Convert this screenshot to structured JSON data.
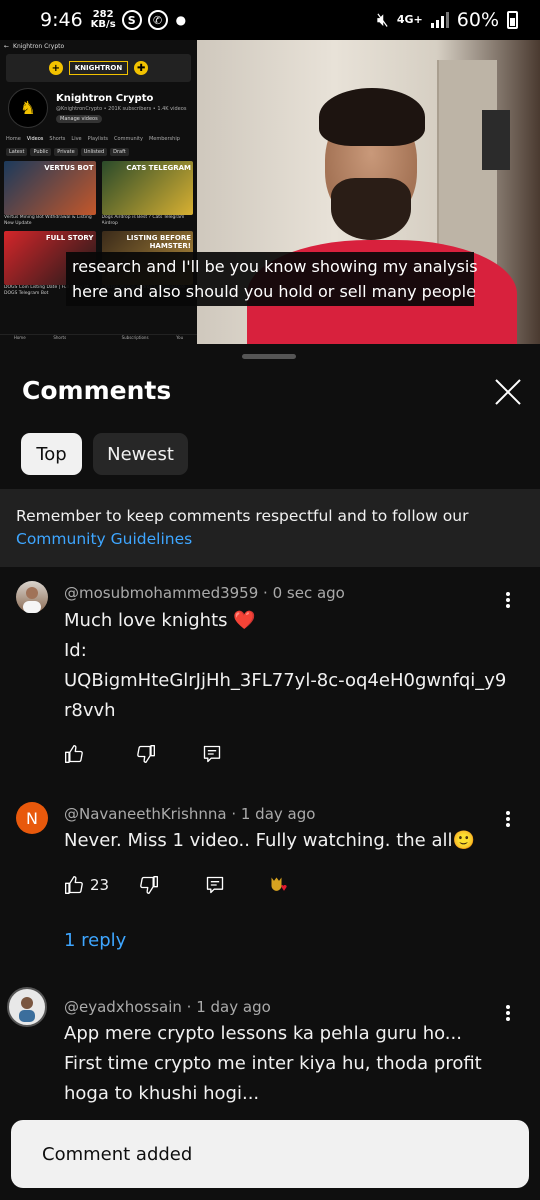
{
  "status_bar": {
    "time": "9:46",
    "net_speed_value": "282",
    "net_speed_unit": "KB/s",
    "network": "4G+",
    "battery": "60%",
    "icons": [
      "s-icon",
      "whatsapp-icon",
      "mute-icon",
      "signal-icon",
      "battery-icon"
    ]
  },
  "video": {
    "subtitle_line1": "research and I'll be you know showing my analysis",
    "subtitle_line2": "here and also should you hold or sell many people",
    "screen": {
      "top_title": "Knightron Crypto",
      "banner": "KNIGHTRON",
      "channel_name": "Knightron Crypto",
      "channel_meta": "@KnightronCrypto • 201K subscribers • 1.4K videos",
      "manage_button": "Manage videos",
      "tabs": [
        "Home",
        "Videos",
        "Shorts",
        "Live",
        "Playlists",
        "Community",
        "Membership"
      ],
      "chips": [
        "Latest",
        "Public",
        "Private",
        "Unlisted",
        "Draft"
      ],
      "thumbs": [
        {
          "title": "VERTUS BOT",
          "caption": "Vertus Mining Bot Withdrawal & Listing New Update"
        },
        {
          "title": "CATS TELEGRAM",
          "caption": "Dogs Airdrop is Best ? Cats Telegram Airdrop"
        },
        {
          "title": "FULL STORY",
          "caption": "DOGS Coin Listing Date | Full Story of DOGS Telegram Bot"
        },
        {
          "title": "LISTING BEFORE HAMSTER!",
          "caption": "Catizen Mining Airdrop Listing Before Hamster Kombat"
        }
      ],
      "nav": [
        "Home",
        "Shorts",
        "",
        "Subscriptions",
        "You"
      ]
    }
  },
  "comments_panel": {
    "title": "Comments",
    "filters": [
      "Top",
      "Newest"
    ],
    "guidelines_text": "Remember to keep comments respectful and to follow our",
    "guidelines_link": "Community Guidelines",
    "comments": [
      {
        "author": "@mosubmohammed3959",
        "time": "0 sec ago",
        "lines": [
          "Much love knights ❤️",
          "Id:",
          "UQBigmHteGlrJjHh_3FL77yl-8c-oq4eH0gwnfqi_y9",
          "r8vvh"
        ],
        "likes": ""
      },
      {
        "author": "@NavaneethKrishnna",
        "avatar_letter": "N",
        "time": "1 day ago",
        "lines": [
          "Never. Miss 1 video.. Fully watching. the all🙂"
        ],
        "likes": "23",
        "replies": "1 reply"
      },
      {
        "author": "@eyadxhossain",
        "time": "1 day ago",
        "lines": [
          "App mere crypto lessons ka pehla guru ho...",
          "First time crypto me inter kiya hu, thoda profit",
          "hoga to khushi hogi..."
        ]
      }
    ]
  },
  "toast": {
    "text": "Comment added"
  },
  "colors": {
    "accent_link": "#3ea6ff",
    "heart": "#e21b2f",
    "avatar_n": "#e8590c"
  }
}
